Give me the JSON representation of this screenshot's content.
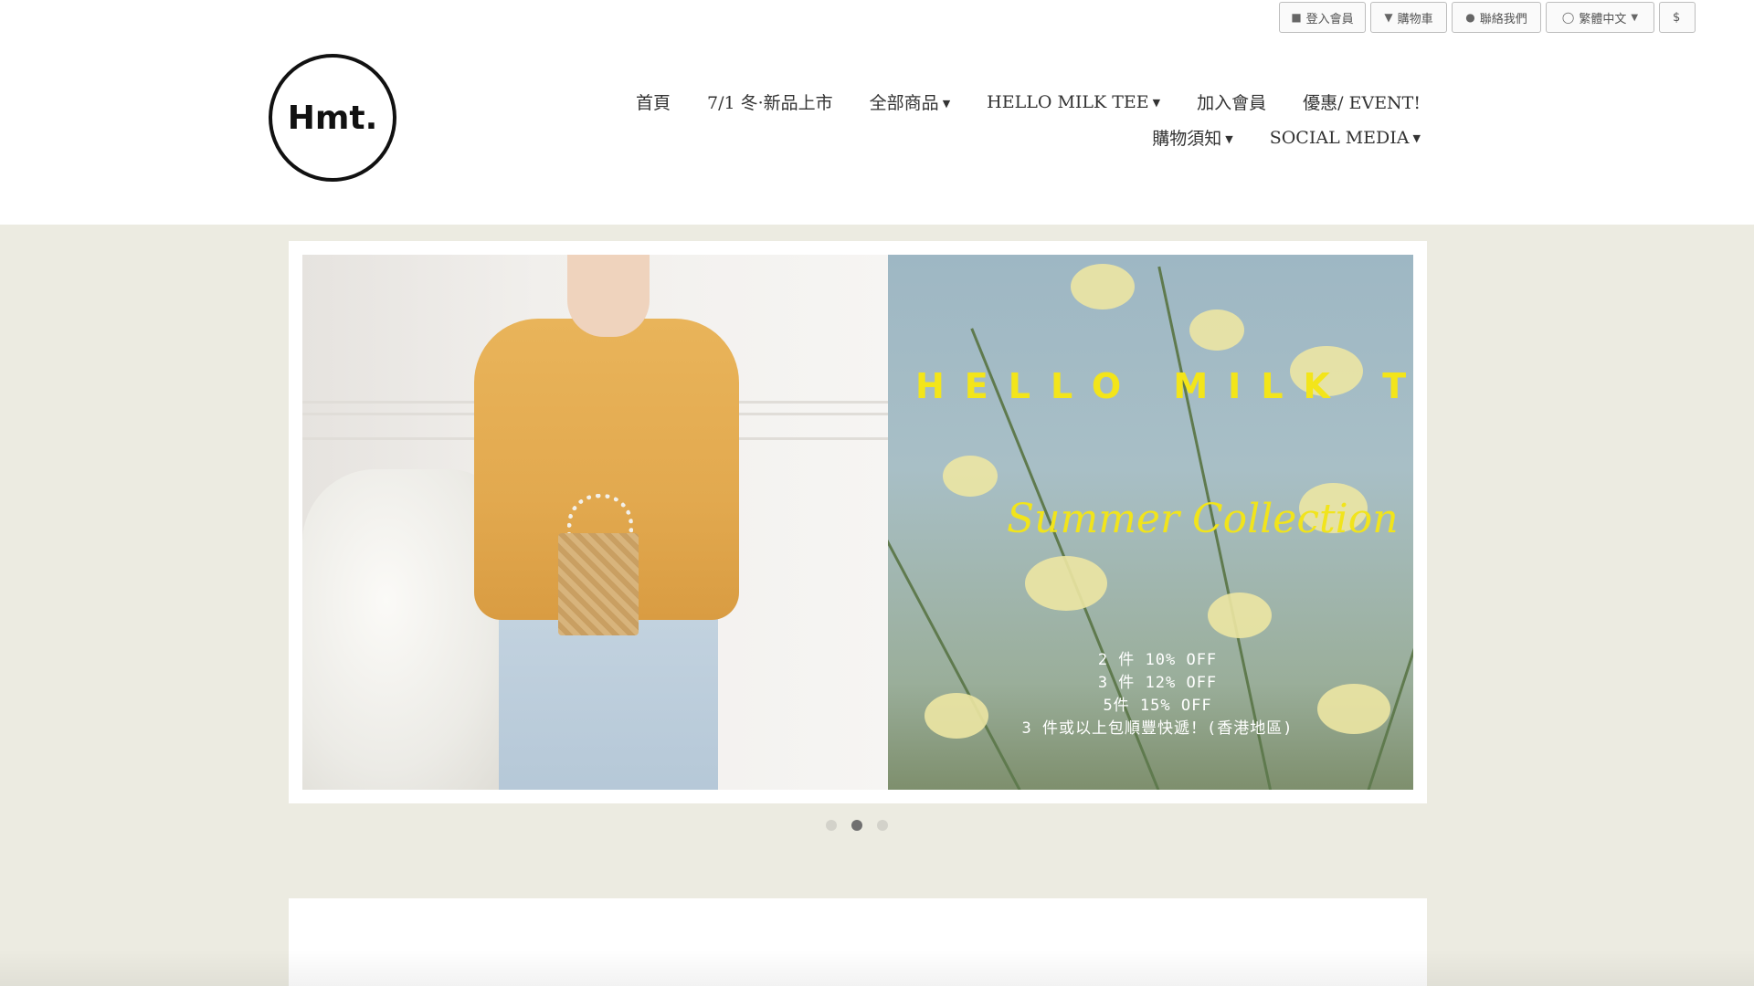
{
  "topbar": {
    "login": {
      "label": "登入會員",
      "icon": "user-icon"
    },
    "cart": {
      "label": "購物車",
      "icon": "cart-icon"
    },
    "contact": {
      "label": "聯絡我們",
      "icon": "chat-bubble-icon"
    },
    "language": {
      "label": "繁體中文",
      "icon": "globe-icon"
    },
    "extra": {
      "label": "$"
    }
  },
  "logo": {
    "text": "Hmt."
  },
  "nav": {
    "row1": [
      {
        "label": "首頁",
        "dropdown": false
      },
      {
        "label": "7/1 冬·新品上市",
        "dropdown": false
      },
      {
        "label": "全部商品",
        "dropdown": true
      },
      {
        "label": "HELLO MILK TEE",
        "dropdown": true
      },
      {
        "label": "加入會員",
        "dropdown": false
      },
      {
        "label": "優惠/ EVENT!",
        "dropdown": false
      }
    ],
    "row2": [
      {
        "label": "購物須知",
        "dropdown": true
      },
      {
        "label": "SOCIAL MEDIA",
        "dropdown": true
      }
    ]
  },
  "banner": {
    "title": "HELLO MILK TEE",
    "subtitle": "Summer Collection",
    "promo": [
      "2 件 10% OFF",
      "3 件 12% OFF",
      "5件 15% OFF",
      "3 件或以上包順豐快遞！(香港地區)"
    ]
  },
  "carousel": {
    "count": 3,
    "active": 2
  },
  "colors": {
    "accent_yellow": "#f3e51a",
    "page_bg": "#ecebe1",
    "dot_active": "#707070"
  }
}
